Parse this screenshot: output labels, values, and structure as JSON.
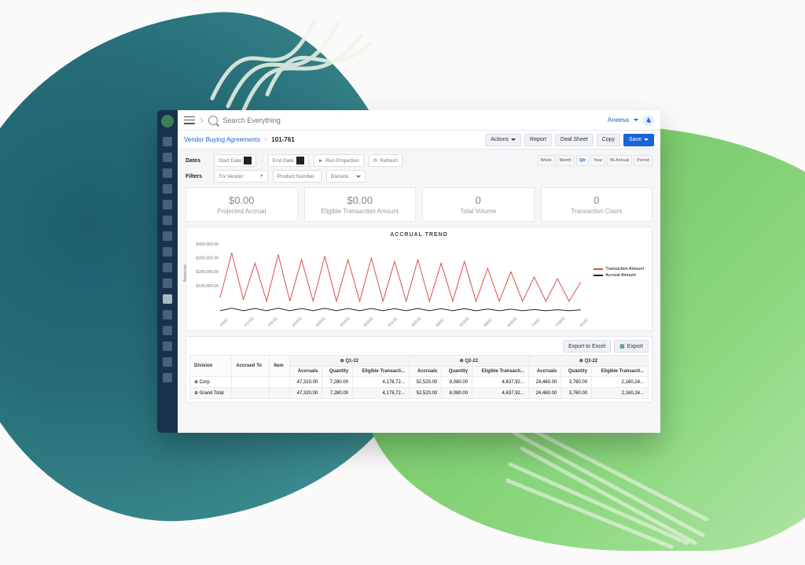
{
  "topbar": {
    "search_placeholder": "Search Everything",
    "user_name": "Aneesa"
  },
  "breadcrumb": {
    "root": "Vendor Buying Agreements",
    "id": "101-761",
    "actions": "Actions",
    "report": "Report",
    "dealsheet": "Deal Sheet",
    "copy": "Copy",
    "save": "Save"
  },
  "filters": {
    "dates_label": "Dates",
    "filters_label": "Filters",
    "start_date": "Start Date",
    "end_date": "End Date",
    "run_projection": "Run Projection",
    "refresh": "Refresh",
    "trx_vendor": "Trx Vendor",
    "product_number": "Product Number",
    "division": "Division",
    "periods": {
      "week": "Week",
      "month": "Month",
      "qtr": "Qtr",
      "year": "Year",
      "biannual": "Bi-Annual",
      "period": "Period"
    }
  },
  "stats": [
    {
      "value": "$0.00",
      "label": "Projected Accrual"
    },
    {
      "value": "$0.00",
      "label": "Eligible Transaction Amount"
    },
    {
      "value": "0",
      "label": "Total Volume"
    },
    {
      "value": "0",
      "label": "Transaction Count"
    }
  ],
  "chart": {
    "title": "ACCRUAL TREND",
    "ylabel": "Amounts",
    "legend": [
      {
        "name": "Transaction Amount",
        "color": "#d9534f"
      },
      {
        "name": "Accrual Amount",
        "color": "#222222"
      }
    ],
    "yticks": [
      "$400,000.00",
      "$300,000.00",
      "$200,000.00",
      "$100,000.00"
    ],
    "xticks": [
      "1/3/22",
      "1/17/22",
      "1/31/22",
      "2/14/22",
      "2/28/22",
      "3/14/22",
      "3/28/22",
      "4/11/22",
      "4/25/22",
      "5/9/22",
      "5/23/22",
      "6/6/22",
      "6/20/22",
      "7/4/22",
      "7/18/22",
      "8/1/22"
    ]
  },
  "table": {
    "export_excel": "Export to Excel",
    "export": "Export",
    "headers": {
      "division": "Division",
      "accrued_to": "Accrued To",
      "item": "Item",
      "q1": "Q1-22",
      "q2": "Q2-22",
      "q3": "Q3-22",
      "accruals": "Accruals",
      "quantity": "Quantity",
      "eligible": "Eligible Transacti..."
    },
    "rows": [
      {
        "label": "Corp",
        "q1a": "47,320.00",
        "q1q": "7,280.00",
        "q1e": "4,178,72...",
        "q2a": "52,520.00",
        "q2q": "8,080.00",
        "q2e": "4,637,92...",
        "q3a": "24,460.00",
        "q3q": "3,760.00",
        "q3e": "2,160,24..."
      },
      {
        "label": "Grand Total",
        "q1a": "47,320.00",
        "q1q": "7,280.00",
        "q1e": "4,178,72...",
        "q2a": "52,520.00",
        "q2q": "8,080.00",
        "q2e": "4,637,92...",
        "q3a": "24,460.00",
        "q3q": "3,760.00",
        "q3e": "2,160,24..."
      }
    ]
  },
  "chart_data": {
    "type": "line",
    "title": "ACCRUAL TREND",
    "ylabel": "Amounts",
    "ylim": [
      0,
      400000
    ],
    "x": [
      "1/3/22",
      "1/10/22",
      "1/17/22",
      "1/24/22",
      "1/31/22",
      "2/7/22",
      "2/14/22",
      "2/21/22",
      "2/28/22",
      "3/7/22",
      "3/14/22",
      "3/21/22",
      "3/28/22",
      "4/4/22",
      "4/11/22",
      "4/18/22",
      "4/25/22",
      "5/2/22",
      "5/9/22",
      "5/16/22",
      "5/23/22",
      "5/30/22",
      "6/6/22",
      "6/13/22",
      "6/20/22",
      "6/27/22",
      "7/4/22",
      "7/11/22",
      "7/18/22",
      "7/25/22",
      "8/1/22",
      "8/8/22"
    ],
    "series": [
      {
        "name": "Transaction Amount",
        "color": "#d9534f",
        "values": [
          80000,
          340000,
          70000,
          280000,
          60000,
          330000,
          60000,
          300000,
          60000,
          320000,
          60000,
          300000,
          60000,
          310000,
          60000,
          290000,
          60000,
          300000,
          60000,
          280000,
          60000,
          290000,
          60000,
          250000,
          60000,
          230000,
          60000,
          200000,
          60000,
          190000,
          60000,
          170000
        ]
      },
      {
        "name": "Accrual Amount",
        "color": "#222222",
        "values": [
          5000,
          20000,
          5000,
          18000,
          5000,
          20000,
          5000,
          18000,
          5000,
          19000,
          5000,
          18000,
          5000,
          18000,
          5000,
          17000,
          5000,
          18000,
          5000,
          17000,
          5000,
          17000,
          5000,
          15000,
          5000,
          14000,
          5000,
          12000,
          5000,
          11000,
          5000,
          10000
        ]
      }
    ]
  }
}
